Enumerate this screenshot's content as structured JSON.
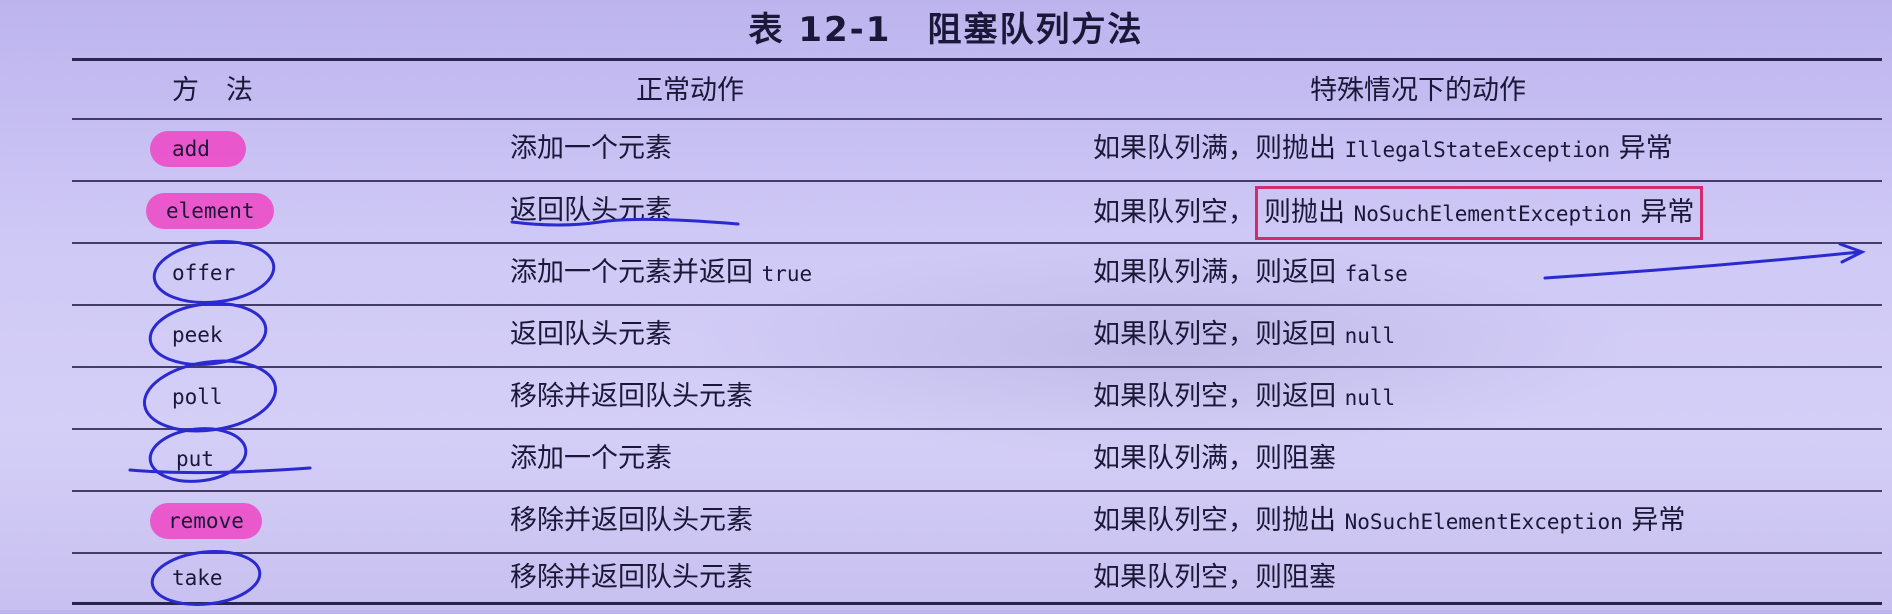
{
  "table": {
    "caption": "表 12-1　阻塞队列方法",
    "headers": {
      "method": "方　法",
      "normal": "正常动作",
      "special": "特殊情况下的动作"
    },
    "rows": [
      {
        "method": "add",
        "normal": "添加一个元素",
        "special_text": "如果队列满，则抛出",
        "special_code": "IllegalStateException",
        "special_tail": "异常",
        "highlighted": true
      },
      {
        "method": "element",
        "normal": "返回队头元素",
        "special_text": "如果队列空，",
        "special_boxed": "则抛出",
        "special_code": "NoSuchElementException",
        "special_tail": "异常",
        "highlighted": true
      },
      {
        "method": "offer",
        "normal_text": "添加一个元素并返回",
        "normal_code": "true",
        "special_text": "如果队列满，则返回",
        "special_code": "false",
        "circled": true
      },
      {
        "method": "peek",
        "normal": "返回队头元素",
        "special_text": "如果队列空，则返回",
        "special_code": "null",
        "circled": true
      },
      {
        "method": "poll",
        "normal": "移除并返回队头元素",
        "special_text": "如果队列空，则返回",
        "special_code": "null",
        "circled": true
      },
      {
        "method": "put",
        "normal": "添加一个元素",
        "special_text": "如果队列满，则阻塞",
        "circled": true
      },
      {
        "method": "remove",
        "normal": "移除并返回队头元素",
        "special_text": "如果队列空，则抛出",
        "special_code": "NoSuchElementException",
        "special_tail": "异常",
        "highlighted": true
      },
      {
        "method": "take",
        "normal": "移除并返回队头元素",
        "special_text": "如果队列空，则阻塞",
        "circled": true
      }
    ]
  },
  "annotations": {
    "highlight_color": "#f23ac0",
    "pen_color": "#2a2ad0",
    "box_color": "#d42a70"
  }
}
